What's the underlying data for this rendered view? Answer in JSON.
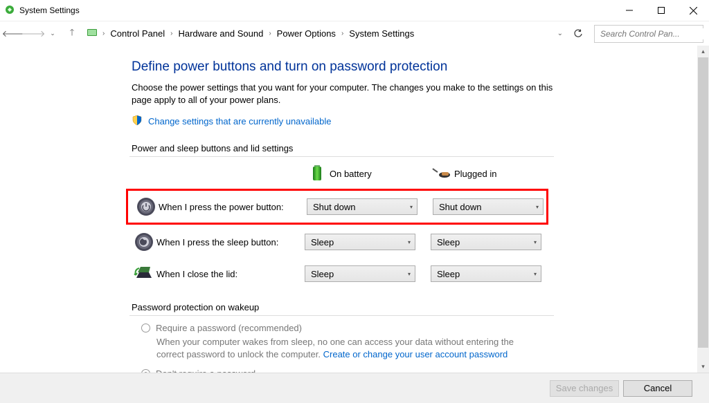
{
  "window": {
    "title": "System Settings"
  },
  "breadcrumb": {
    "b1": "Control Panel",
    "b2": "Hardware and Sound",
    "b3": "Power Options",
    "b4": "System Settings"
  },
  "search": {
    "placeholder": "Search Control Pan..."
  },
  "main": {
    "heading": "Define power buttons and turn on password protection",
    "desc": "Choose the power settings that you want for your computer. The changes you make to the settings on this page apply to all of your power plans.",
    "change_link": "Change settings that are currently unavailable",
    "section1": "Power and sleep buttons and lid settings",
    "col_battery": "On battery",
    "col_plugged": "Plugged in",
    "rows": {
      "power": {
        "label": "When I press the power button:",
        "battery": "Shut down",
        "plugged": "Shut down"
      },
      "sleep": {
        "label": "When I press the sleep button:",
        "battery": "Sleep",
        "plugged": "Sleep"
      },
      "lid": {
        "label": "When I close the lid:",
        "battery": "Sleep",
        "plugged": "Sleep"
      }
    },
    "section2": "Password protection on wakeup",
    "radio1": {
      "label": "Require a password (recommended)",
      "desc_a": "When your computer wakes from sleep, no one can access your data without entering the correct password to unlock the computer. ",
      "link": "Create or change your user account password"
    },
    "radio2": {
      "label": "Don't require a password"
    }
  },
  "footer": {
    "save": "Save changes",
    "cancel": "Cancel"
  }
}
